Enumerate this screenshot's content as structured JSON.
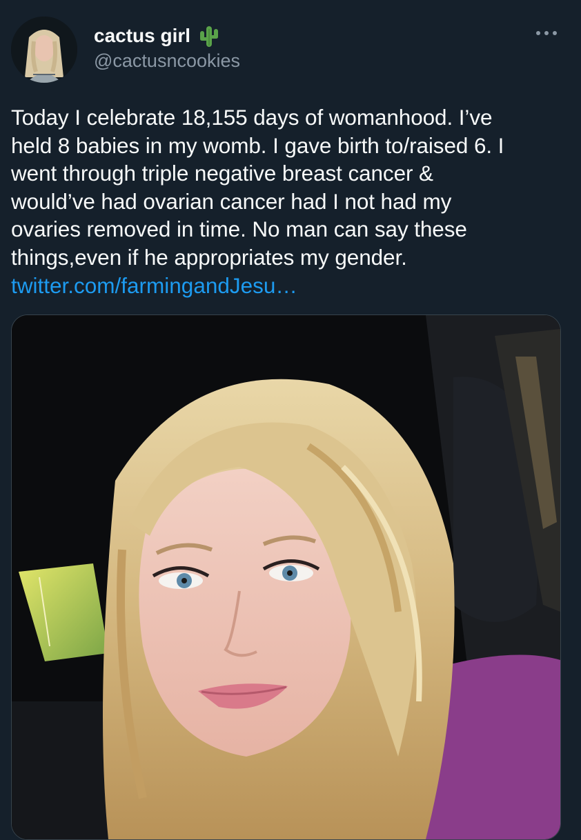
{
  "tweet": {
    "author": {
      "display_name": "cactus girl",
      "name_emoji": "cactus-emoji",
      "handle": "@cactusncookies",
      "avatar": "profile-photo"
    },
    "text": "Today I celebrate 18,155 days of womanhood. I’ve\nheld 8 babies in my womb. I gave birth to/raised 6. I\nwent through triple negative breast cancer &\nwould’ve had ovarian cancer had I not had my\novaries removed in time. No man can say these\nthings,even if he appropriates my gender.",
    "link": "twitter.com/farmingandJesu…",
    "media": {
      "type": "photo",
      "subject": "selfie in car"
    },
    "more_icon": "more-dots-icon"
  },
  "colors": {
    "background": "#15202b",
    "primary_text": "#f7f9f9",
    "secondary_text": "#8b98a5",
    "link": "#1d9bf0",
    "border": "#38444d"
  }
}
